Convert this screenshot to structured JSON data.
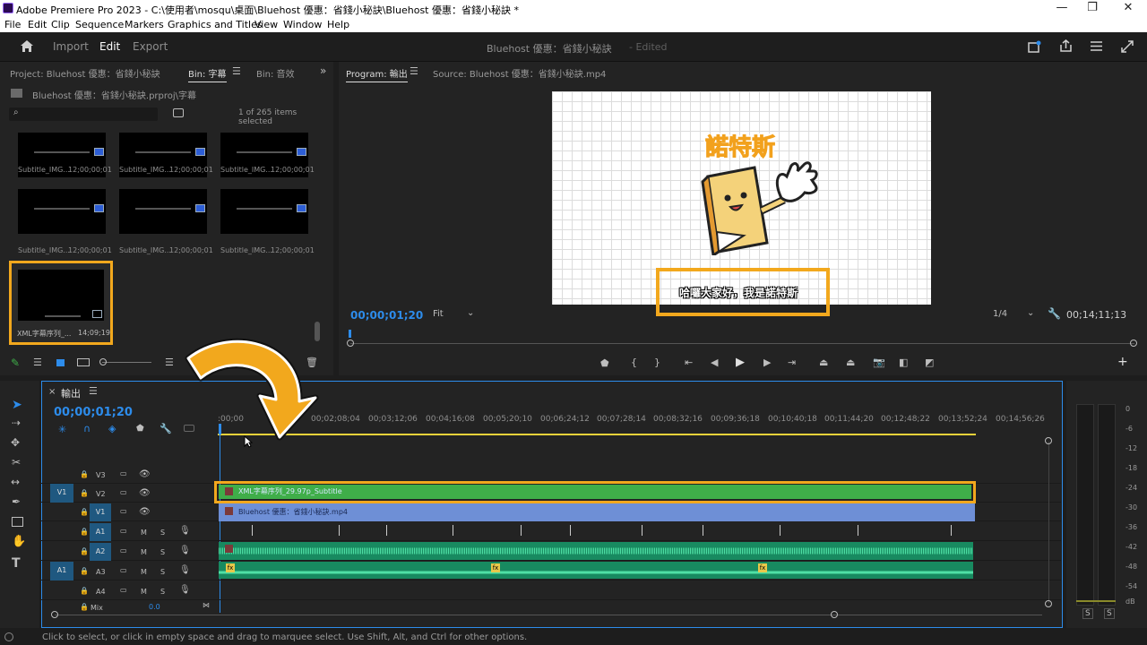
{
  "window": {
    "title": "Adobe Premiere Pro 2023 - C:\\使用者\\mosqu\\桌面\\Bluehost 優惠：省錢小秘訣\\Bluehost 優惠：省錢小秘訣 *",
    "minimize": "—",
    "restore": "❐",
    "close": "✕"
  },
  "menu": [
    "File",
    "Edit",
    "Clip",
    "Sequence",
    "Markers",
    "Graphics and Titles",
    "View",
    "Window",
    "Help"
  ],
  "header": {
    "tabs": [
      "Import",
      "Edit",
      "Export"
    ],
    "active": "Edit",
    "project_title": "Bluehost 優惠：省錢小秘訣",
    "edited": "- Edited"
  },
  "project": {
    "tabs": [
      "Project: Bluehost 優惠：省錢小秘訣",
      "Bin: 字幕",
      "Bin: 音效"
    ],
    "path": "Bluehost 優惠：省錢小秘訣.prproj\\字幕",
    "items_selected": "1 of 265 items selected",
    "thumbnails": [
      {
        "name": "Subtitle_IMG...",
        "duration": "12;00;00;01"
      },
      {
        "name": "Subtitle_IMG...",
        "duration": "12;00;00;01"
      },
      {
        "name": "Subtitle_IMG...",
        "duration": "12;00;00;01"
      },
      {
        "name": "Subtitle_IMG...",
        "duration": "12;00;00;01"
      },
      {
        "name": "Subtitle_IMG...",
        "duration": "12;00;00;01"
      },
      {
        "name": "Subtitle_IMG...",
        "duration": "12;00;00;01"
      },
      {
        "name": "XML字幕序列_...",
        "duration": "14;09;19"
      }
    ]
  },
  "program": {
    "tabs": [
      "Program: 輸出",
      "Source: Bluehost 優惠：省錢小秘訣.mp4"
    ],
    "timecode": "00;00;01;20",
    "fit": "Fit",
    "resolution": "1/4",
    "duration": "00;14;11;13",
    "video_title": "諾特斯",
    "subtitle": "哈囉大家好，我是諾特斯"
  },
  "timeline": {
    "tab": "輸出",
    "timecode": "00;00;01;20",
    "ruler": [
      ":00;00",
      "00;02;08;04",
      "00;03;12;06",
      "00;04;16;08",
      "00;05;20;10",
      "00;06;24;12",
      "00;07;28;14",
      "00;08;32;16",
      "00;09;36;18",
      "00;10;40;18",
      "00;11;44;20",
      "00;12;48;22",
      "00;13;52;24",
      "00;14;56;26"
    ],
    "video_tracks": [
      "V3",
      "V2",
      "V1"
    ],
    "audio_tracks": [
      "A1",
      "A2",
      "A3",
      "A4"
    ],
    "mix": "Mix",
    "mix_value": "0.0",
    "source_v": "V1",
    "source_a": "A1",
    "clip_subtitle": "XML字幕序列_29.97p_Subtitle",
    "clip_video": "Bluehost 優惠：省錢小秘訣.mp4",
    "fx": "fx"
  },
  "meter": {
    "labels": [
      "0",
      "-6",
      "-12",
      "-18",
      "-24",
      "-30",
      "-36",
      "-42",
      "-48",
      "-54",
      "dB"
    ],
    "solo": [
      "S",
      "S"
    ]
  },
  "status": "Click to select, or click in empty space and drag to marquee select. Use Shift, Alt, and Ctrl for other options.",
  "colors": {
    "accent": "#2d8ceb",
    "highlight": "#f2a81d",
    "subtitle_clip": "#3fae49",
    "video_clip": "#6e8fd6",
    "audio": "#1f9c6e"
  }
}
